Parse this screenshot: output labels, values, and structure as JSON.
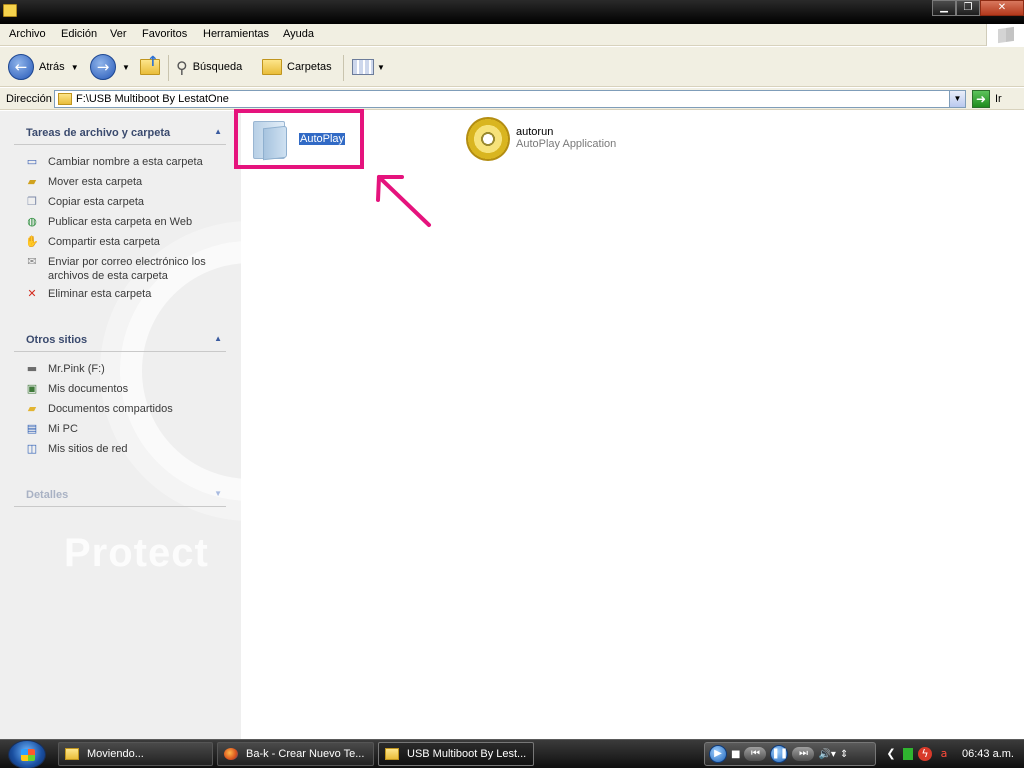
{
  "menu": {
    "items": [
      "Archivo",
      "Edición",
      "Ver",
      "Favoritos",
      "Herramientas",
      "Ayuda"
    ]
  },
  "toolbar": {
    "back_label": "Atrás",
    "search_label": "Búsqueda",
    "folders_label": "Carpetas"
  },
  "address": {
    "label": "Dirección",
    "value": "F:\\USB Multiboot By LestatOne",
    "go_label": "Ir"
  },
  "taskpane": {
    "file_tasks": {
      "title": "Tareas de archivo y carpeta",
      "items": [
        {
          "label": "Cambiar nombre a esta carpeta",
          "icon": "rename-icon"
        },
        {
          "label": "Mover esta carpeta",
          "icon": "move-folder-icon"
        },
        {
          "label": "Copiar esta carpeta",
          "icon": "copy-folder-icon"
        },
        {
          "label": "Publicar esta carpeta en Web",
          "icon": "publish-web-icon"
        },
        {
          "label": "Compartir esta carpeta",
          "icon": "share-folder-icon"
        },
        {
          "label": "Enviar por correo electrónico los archivos de esta carpeta",
          "icon": "email-icon"
        },
        {
          "label": "Eliminar esta carpeta",
          "icon": "delete-icon"
        }
      ]
    },
    "other_places": {
      "title": "Otros sitios",
      "items": [
        {
          "label": "Mr.Pink (F:)",
          "icon": "drive-icon"
        },
        {
          "label": "Mis documentos",
          "icon": "my-documents-icon"
        },
        {
          "label": "Documentos compartidos",
          "icon": "shared-documents-icon"
        },
        {
          "label": "Mi PC",
          "icon": "my-computer-icon"
        },
        {
          "label": "Mis sitios de red",
          "icon": "network-places-icon"
        }
      ]
    },
    "details": {
      "title": "Detalles"
    }
  },
  "files": [
    {
      "name": "AutoPlay",
      "type": "",
      "icon": "folder-icon",
      "selected": true
    },
    {
      "name": "autorun",
      "type": "AutoPlay Application",
      "icon": "cd-icon",
      "selected": false
    }
  ],
  "taskbar": {
    "tasks": [
      {
        "label": "Moviendo...",
        "icon": "folder-icon"
      },
      {
        "label": "Ba-k - Crear Nuevo Te...",
        "icon": "firefox-icon"
      },
      {
        "label": "USB Multiboot By Lest...",
        "icon": "folder-icon",
        "active": true
      }
    ],
    "clock": "06:43 a.m."
  },
  "colors": {
    "highlight": "#e5137d",
    "selection": "#316ac5"
  }
}
